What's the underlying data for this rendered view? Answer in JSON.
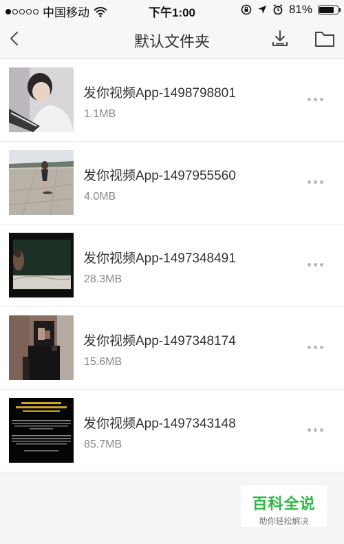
{
  "status_bar": {
    "carrier": "中国移动",
    "time": "下午1:00",
    "battery": "81%"
  },
  "nav": {
    "title": "默认文件夹"
  },
  "files": [
    {
      "name": "发你视频App-1498798801",
      "size": "1.1MB"
    },
    {
      "name": "发你视频App-1497955560",
      "size": "4.0MB"
    },
    {
      "name": "发你视频App-1497348491",
      "size": "28.3MB"
    },
    {
      "name": "发你视频App-1497348174",
      "size": "15.6MB"
    },
    {
      "name": "发你视频App-1497343148",
      "size": "85.7MB"
    }
  ],
  "watermark": {
    "title": "百科全说",
    "subtitle": "助你轻松解决"
  }
}
